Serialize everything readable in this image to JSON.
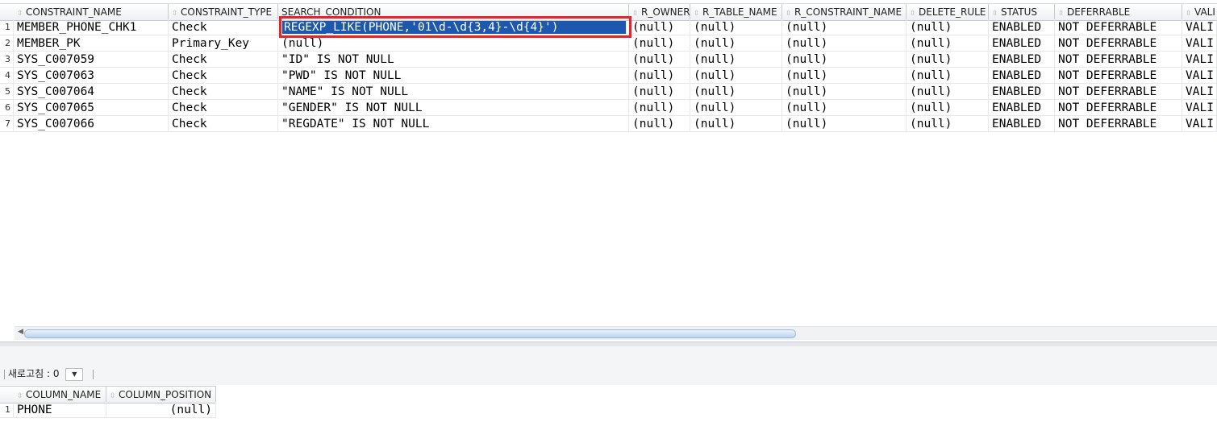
{
  "grid": {
    "columns": [
      "CONSTRAINT_NAME",
      "CONSTRAINT_TYPE",
      "SEARCH_CONDITION",
      "R_OWNER",
      "R_TABLE_NAME",
      "R_CONSTRAINT_NAME",
      "DELETE_RULE",
      "STATUS",
      "DEFERRABLE",
      "VALI"
    ],
    "rows": [
      {
        "n": "1",
        "name": "MEMBER_PHONE_CHK1",
        "type": "Check",
        "cond": "REGEXP_LIKE(PHONE,'01\\d-\\d{3,4}-\\d{4}')",
        "r_owner": "(null)",
        "r_table": "(null)",
        "r_cons": "(null)",
        "del": "(null)",
        "status": "ENABLED",
        "defer": "NOT DEFERRABLE",
        "vali": "VALI"
      },
      {
        "n": "2",
        "name": "MEMBER_PK",
        "type": "Primary_Key",
        "cond": "(null)",
        "r_owner": "(null)",
        "r_table": "(null)",
        "r_cons": "(null)",
        "del": "(null)",
        "status": "ENABLED",
        "defer": "NOT DEFERRABLE",
        "vali": "VALI"
      },
      {
        "n": "3",
        "name": "SYS_C007059",
        "type": "Check",
        "cond": "\"ID\" IS NOT NULL",
        "r_owner": "(null)",
        "r_table": "(null)",
        "r_cons": "(null)",
        "del": "(null)",
        "status": "ENABLED",
        "defer": "NOT DEFERRABLE",
        "vali": "VALI"
      },
      {
        "n": "4",
        "name": "SYS_C007063",
        "type": "Check",
        "cond": "\"PWD\" IS NOT NULL",
        "r_owner": "(null)",
        "r_table": "(null)",
        "r_cons": "(null)",
        "del": "(null)",
        "status": "ENABLED",
        "defer": "NOT DEFERRABLE",
        "vali": "VALI"
      },
      {
        "n": "5",
        "name": "SYS_C007064",
        "type": "Check",
        "cond": "\"NAME\" IS NOT NULL",
        "r_owner": "(null)",
        "r_table": "(null)",
        "r_cons": "(null)",
        "del": "(null)",
        "status": "ENABLED",
        "defer": "NOT DEFERRABLE",
        "vali": "VALI"
      },
      {
        "n": "6",
        "name": "SYS_C007065",
        "type": "Check",
        "cond": "\"GENDER\" IS NOT NULL",
        "r_owner": "(null)",
        "r_table": "(null)",
        "r_cons": "(null)",
        "del": "(null)",
        "status": "ENABLED",
        "defer": "NOT DEFERRABLE",
        "vali": "VALI"
      },
      {
        "n": "7",
        "name": "SYS_C007066",
        "type": "Check",
        "cond": "\"REGDATE\" IS NOT NULL",
        "r_owner": "(null)",
        "r_table": "(null)",
        "r_cons": "(null)",
        "del": "(null)",
        "status": "ENABLED",
        "defer": "NOT DEFERRABLE",
        "vali": "VALI"
      }
    ],
    "selected_cell_color": "#1c58ad",
    "highlight_box_color": "#e2262b"
  },
  "refresh": {
    "label": "새로고침 :",
    "value": "0"
  },
  "columns_grid": {
    "columns": [
      "COLUMN_NAME",
      "COLUMN_POSITION"
    ],
    "rows": [
      {
        "n": "1",
        "col": "PHONE",
        "pos": "(null)"
      }
    ]
  },
  "icons": {
    "sort": "sort-icon",
    "dropdown": "chevron-down-icon",
    "scroll_left": "arrow-left-icon"
  }
}
